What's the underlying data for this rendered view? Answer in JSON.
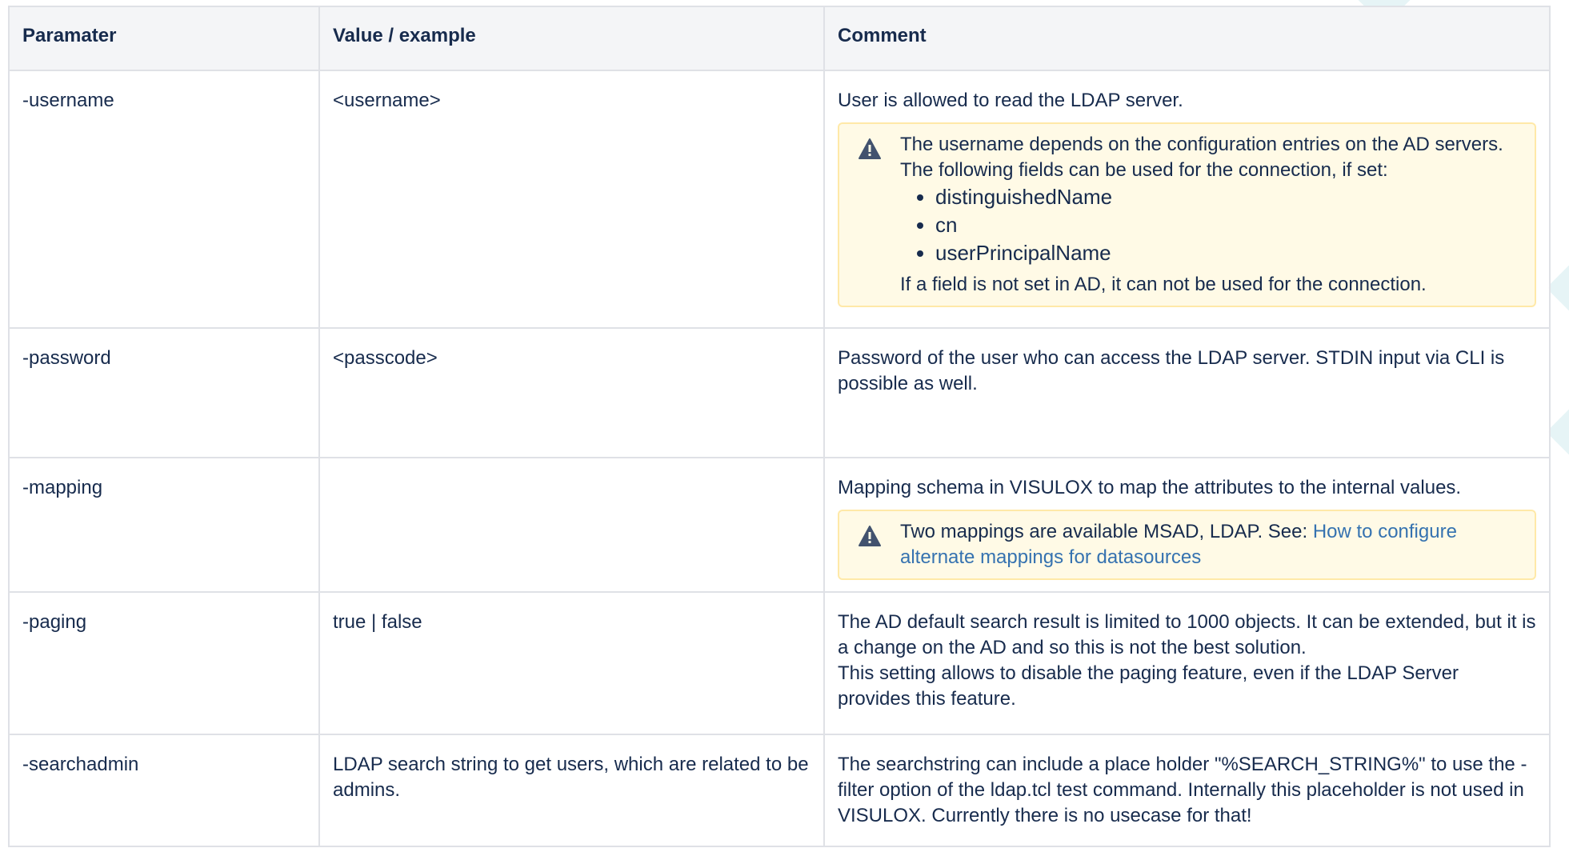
{
  "table": {
    "headers": [
      "Paramater",
      "Value / example",
      "Comment"
    ],
    "rows": {
      "username": {
        "param": "-username",
        "value": "<username>",
        "comment": "User is allowed to read the LDAP server.",
        "warning": {
          "icon": "warning-icon",
          "line1": "The username depends on the configuration entries on the AD servers.",
          "line2": "The following fields can be used for the connection, if set:",
          "items": [
            "distinguishedName",
            "cn",
            "userPrincipalName"
          ],
          "after": "If a field is not set in AD, it can not be used for the connection."
        }
      },
      "password": {
        "param": "-password",
        "value": "<passcode>",
        "comment": "Password of the user who can access the LDAP server. STDIN input via CLI is possible as well."
      },
      "mapping": {
        "param": "-mapping",
        "value": "",
        "comment": "Mapping schema in VISULOX to map the attributes to the internal values.",
        "warning": {
          "icon": "warning-icon",
          "text": "Two mappings are available MSAD, LDAP.  See: ",
          "link": "How to configure alternate mappings for datasources"
        }
      },
      "paging": {
        "param": "-paging",
        "value": "true | false",
        "comment1": "The AD default search result is limited to 1000 objects. It can be extended, but it is a change on the AD and so this is not the best solution.",
        "comment2": "This setting allows to disable the paging feature, even if the LDAP Server provides this feature."
      },
      "searchadmin": {
        "param": "-searchadmin",
        "value": "LDAP search string to get users, which are related to be admins.",
        "comment": "The searchstring can include a place holder \"%SEARCH_STRING%\" to use the -filter option of the ldap.tcl test command. Internally this placeholder is not used in VISULOX. Currently there is no usecase for that!"
      }
    }
  },
  "colors": {
    "header_bg": "#f4f5f7",
    "border": "#dfe1e6",
    "warning_bg": "#fffae6",
    "warning_border": "#ffe9a8",
    "link": "#3572b0",
    "text": "#172b4d"
  }
}
